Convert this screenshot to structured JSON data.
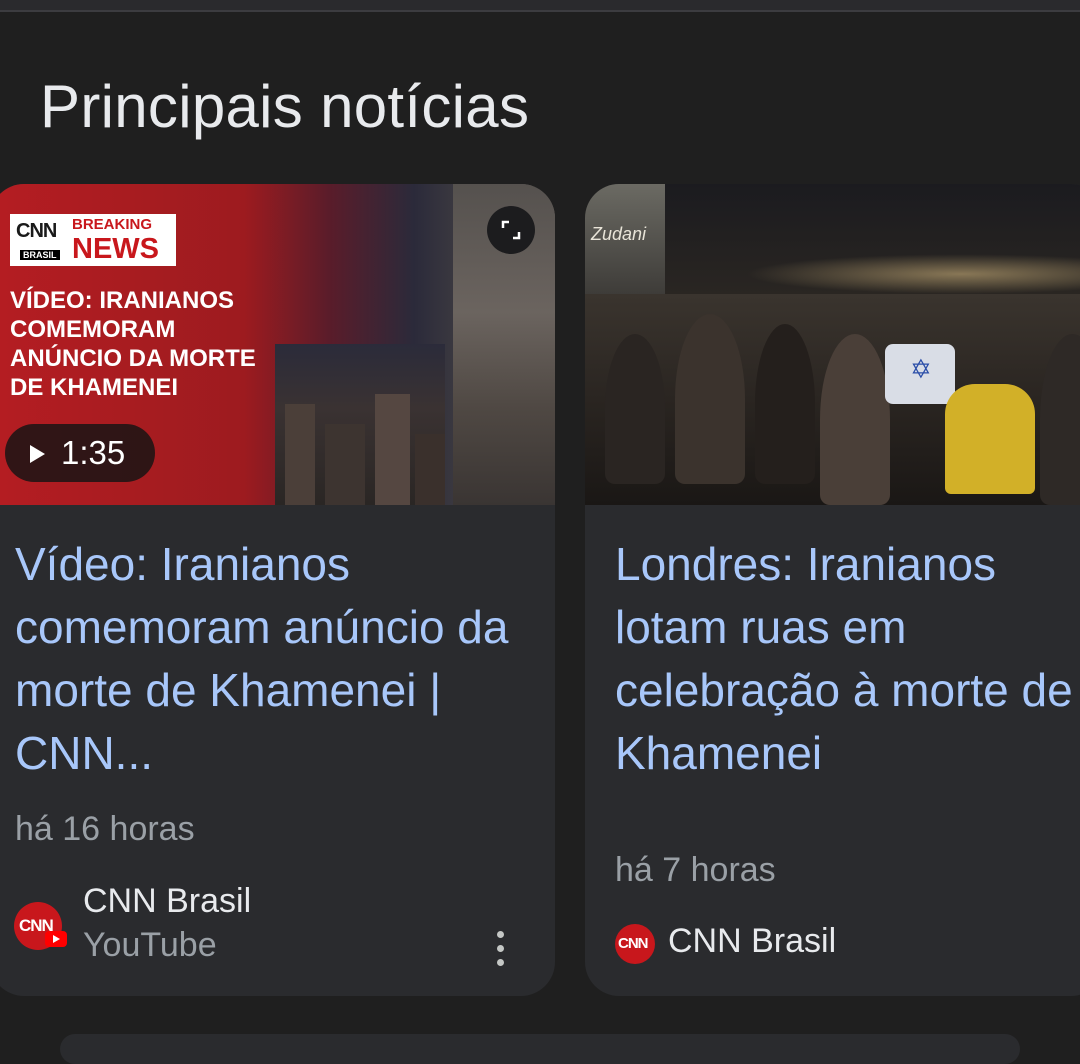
{
  "section": {
    "title": "Principais notícias"
  },
  "cards": [
    {
      "thumbnail": {
        "brand": "CNN",
        "brand_sub": "BRASIL",
        "badge_line1": "BREAKING",
        "badge_line2": "NEWS",
        "overlay_headline": "VÍDEO: IRANIANOS COMEMORAM ANÚNCIO DA MORTE DE KHAMENEI",
        "duration": "1:35",
        "expand_icon": "expand-icon",
        "play_icon": "play-icon"
      },
      "title": "Vídeo: Iranianos comemoram anúncio da morte de Khamenei | CNN...",
      "time_ago": "há 16 horas",
      "source_name": "CNN Brasil",
      "source_platform": "YouTube",
      "logo_text": "CNN",
      "more_icon": "more-vert-icon"
    },
    {
      "thumbnail": {
        "storefront_text": "Zudani"
      },
      "title": "Londres: Iranianos lotam ruas em celebração à morte de Khamenei",
      "time_ago": "há 7 horas",
      "source_name": "CNN Brasil",
      "logo_text": "CNN"
    }
  ],
  "colors": {
    "background": "#1f1f1f",
    "card": "#2a2b2e",
    "link": "#a8c7fa",
    "secondary_text": "#9aa0a6",
    "brand_red": "#c8171c"
  }
}
